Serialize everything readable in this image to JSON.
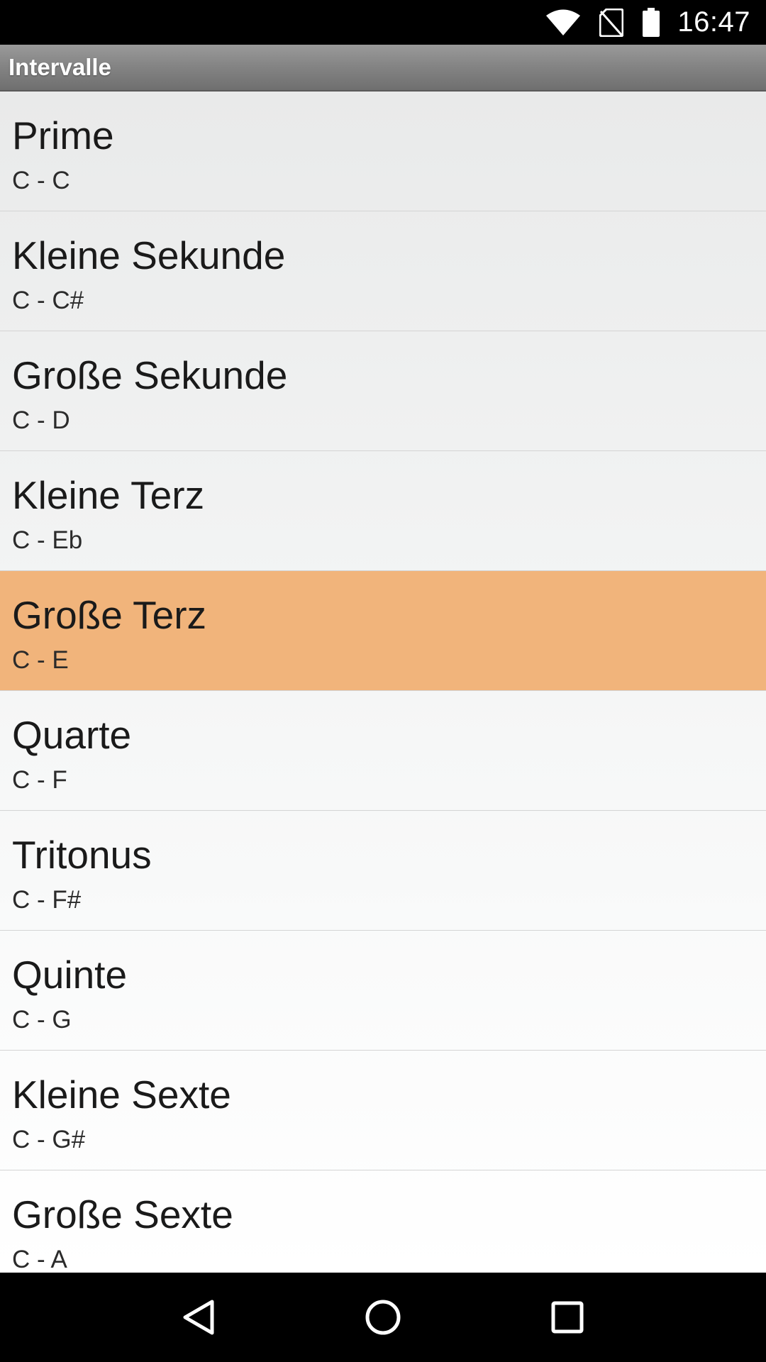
{
  "status_bar": {
    "time": "16:47",
    "icons": [
      "wifi-icon",
      "no-sim-icon",
      "battery-icon"
    ]
  },
  "title_bar": {
    "title": "Intervalle"
  },
  "intervals": [
    {
      "name": "Prime",
      "notes": "C - C"
    },
    {
      "name": "Kleine Sekunde",
      "notes": "C - C#"
    },
    {
      "name": "Große Sekunde",
      "notes": "C - D"
    },
    {
      "name": "Kleine Terz",
      "notes": "C - Eb"
    },
    {
      "name": "Große Terz",
      "notes": "C - E"
    },
    {
      "name": "Quarte",
      "notes": "C - F"
    },
    {
      "name": "Tritonus",
      "notes": "C - F#"
    },
    {
      "name": "Quinte",
      "notes": "C - G"
    },
    {
      "name": "Kleine Sexte",
      "notes": "C - G#"
    },
    {
      "name": "Große Sexte",
      "notes": "C - A"
    }
  ],
  "selected_index": 4,
  "colors": {
    "selected_row": "#f1b47b",
    "title_bar": "#858585"
  },
  "nav_bar": {
    "buttons": [
      "back-icon",
      "home-icon",
      "recents-icon"
    ]
  }
}
